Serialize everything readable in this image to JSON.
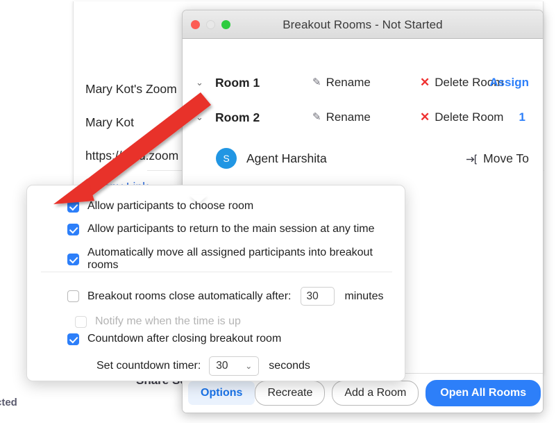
{
  "background": {
    "meeting_title": "Mary Kot's Zoom",
    "host_name": "Mary Kot",
    "invite_url": "https://umd.zoom",
    "copy_link": "Copy Link",
    "share_screen_partial": "Share Scr",
    "status_partial": "cted"
  },
  "window": {
    "title": "Breakout Rooms - Not Started",
    "traffic_lights": [
      "close-button",
      "minimize-button",
      "maximize-button"
    ],
    "rooms": [
      {
        "name": "Room 1",
        "chevron": "⌄",
        "rename_label": "Rename",
        "delete_label": "Delete Room",
        "right_label": "Assign",
        "right_kind": "assign"
      },
      {
        "name": "Room 2",
        "chevron": "⌄",
        "rename_label": "Rename",
        "delete_label": "Delete Room",
        "right_label": "1",
        "right_kind": "count"
      }
    ],
    "participant": {
      "avatar_initial": "S",
      "name": "Agent Harshita",
      "move_to_label": "Move To"
    },
    "footer": {
      "options_label": "Options",
      "recreate_label": "Recreate",
      "add_room_label": "Add a Room",
      "open_all_label": "Open All Rooms"
    }
  },
  "options_popup": {
    "checkboxes": [
      {
        "label": "Allow participants to choose room",
        "checked": true,
        "disabled": false
      },
      {
        "label": "Allow participants to return to the main session at any time",
        "checked": true,
        "disabled": false
      },
      {
        "label": "Automatically move all assigned participants into breakout rooms",
        "checked": true,
        "disabled": false
      }
    ],
    "auto_close": {
      "label": "Breakout rooms close automatically after:",
      "checked": false,
      "value": "30",
      "unit": "minutes"
    },
    "notify": {
      "label": "Notify me when the time is up",
      "checked": false,
      "disabled": true
    },
    "countdown": {
      "label": "Countdown after closing breakout room",
      "checked": true
    },
    "countdown_timer": {
      "label": "Set countdown timer:",
      "value": "30",
      "unit": "seconds",
      "chevron": "⌄"
    }
  },
  "annotation": {
    "arrow_color": "#e8302a",
    "kind": "pointer-arrow"
  }
}
